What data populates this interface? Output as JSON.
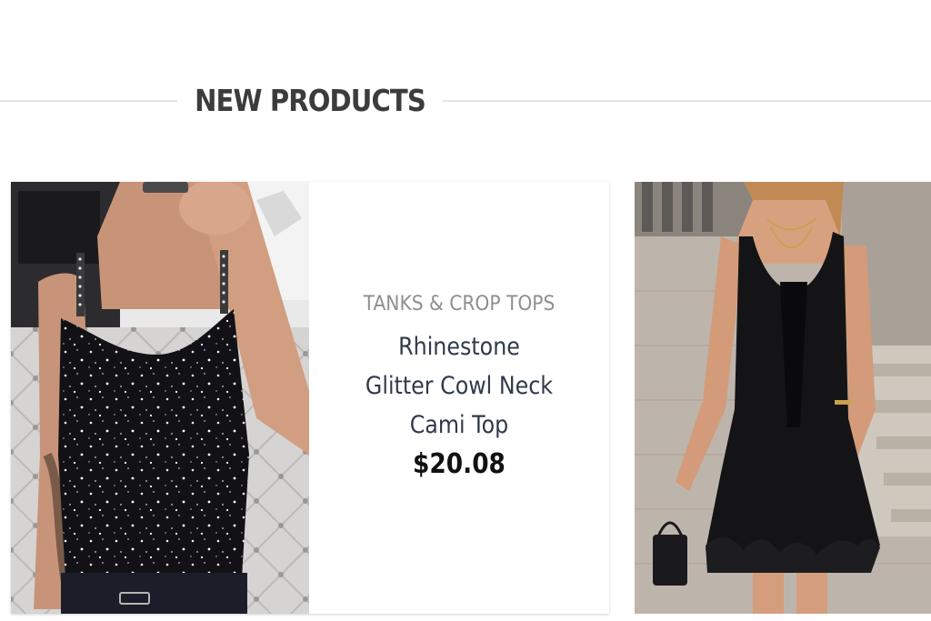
{
  "section": {
    "title": "NEW PRODUCTS"
  },
  "products": [
    {
      "category": "TANKS & CROP TOPS",
      "name": "Rhinestone Glitter Cowl Neck Cami Top",
      "price": "$20.08",
      "image": "black-glitter-cami-photo"
    },
    {
      "image": "black-ruffle-dress-photo"
    }
  ]
}
